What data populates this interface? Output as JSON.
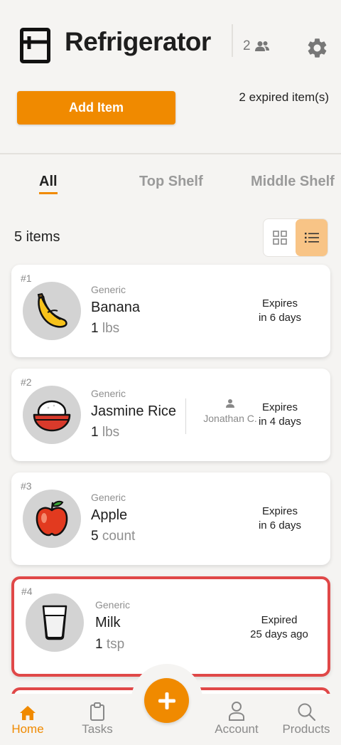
{
  "header": {
    "title": "Refrigerator",
    "member_count": "2",
    "add_button_label": "Add Item",
    "expired_note": "2 expired item(s)"
  },
  "tabs": [
    {
      "label": "All",
      "active": true
    },
    {
      "label": "Top Shelf",
      "active": false
    },
    {
      "label": "Middle Shelf",
      "active": false
    }
  ],
  "list": {
    "count_label": "5 items",
    "view_mode": "list"
  },
  "items": [
    {
      "index": "#1",
      "category": "Generic",
      "name": "Banana",
      "qty": "1",
      "unit": "lbs",
      "expiry_line1": "Expires",
      "expiry_line2": "in 6 days",
      "icon": "banana-icon",
      "expired": false
    },
    {
      "index": "#2",
      "category": "Generic",
      "name": "Jasmine Rice",
      "qty": "1",
      "unit": "lbs",
      "owner": "Jonathan C.",
      "expiry_line1": "Expires",
      "expiry_line2": "in 4 days",
      "icon": "rice-bowl-icon",
      "expired": false
    },
    {
      "index": "#3",
      "category": "Generic",
      "name": "Apple",
      "qty": "5",
      "unit": "count",
      "expiry_line1": "Expires",
      "expiry_line2": "in 6 days",
      "icon": "apple-icon",
      "expired": false
    },
    {
      "index": "#4",
      "category": "Generic",
      "name": "Milk",
      "qty": "1",
      "unit": "tsp",
      "expiry_line1": "Expired",
      "expiry_line2": "25 days ago",
      "icon": "milk-glass-icon",
      "expired": true
    }
  ],
  "nav": {
    "home": "Home",
    "tasks": "Tasks",
    "account": "Account",
    "products": "Products"
  },
  "colors": {
    "accent": "#f08a00",
    "expired_border": "#e04848",
    "background": "#f5f4f2"
  }
}
